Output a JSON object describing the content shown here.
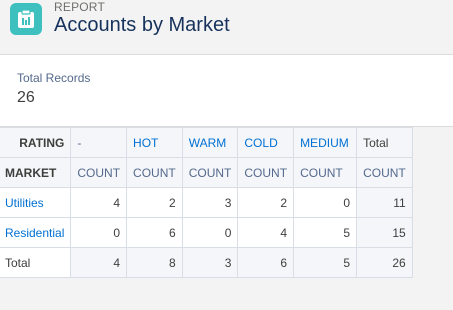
{
  "header": {
    "eyebrow": "REPORT",
    "title": "Accounts by Market",
    "icon": "report-icon",
    "icon_color": "#3ec0bf"
  },
  "summary": {
    "label": "Total Records",
    "value": "26"
  },
  "matrix": {
    "rating_label": "RATING",
    "market_label": "MARKET",
    "rating_columns": [
      "-",
      "HOT",
      "WARM",
      "COLD",
      "MEDIUM"
    ],
    "total_label": "Total",
    "count_label": "COUNT",
    "rows": [
      {
        "label": "Utilities",
        "values": [
          "4",
          "2",
          "3",
          "2",
          "0"
        ],
        "total": "11"
      },
      {
        "label": "Residential",
        "values": [
          "0",
          "6",
          "0",
          "4",
          "5"
        ],
        "total": "15"
      }
    ],
    "totals_row": {
      "label": "Total",
      "values": [
        "4",
        "8",
        "3",
        "6",
        "5"
      ],
      "total": "26"
    }
  },
  "colors": {
    "link": "#0070d2",
    "title": "#16325c",
    "header_bg": "#f4f6f9",
    "border": "#d8dde6"
  }
}
